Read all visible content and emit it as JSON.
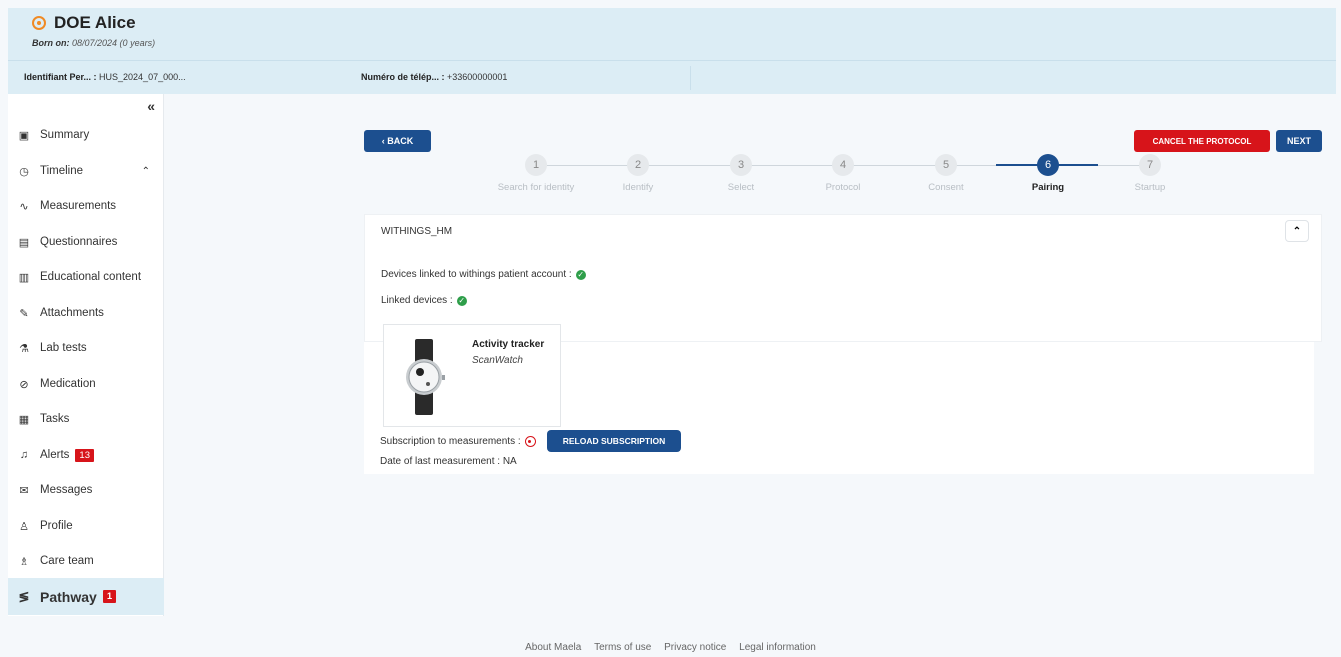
{
  "patient": {
    "name": "DOE Alice",
    "born_label": "Born on:",
    "born_value": "08/07/2024 (0 years)"
  },
  "infobar": {
    "id_label": "Identifiant Per... :",
    "id_value": "HUS_2024_07_000...",
    "phone_label": "Numéro de télép... :",
    "phone_value": "+33600000001"
  },
  "sidebar": {
    "collapse_label": "«",
    "items": [
      {
        "label": "Summary",
        "icon": "summary-icon",
        "glyph": "▣"
      },
      {
        "label": "Timeline",
        "icon": "clock-icon",
        "glyph": "◷"
      },
      {
        "label": "Measurements",
        "icon": "pulse-icon",
        "glyph": "∿"
      },
      {
        "label": "Questionnaires",
        "icon": "questionnaire-icon",
        "glyph": "▤"
      },
      {
        "label": "Educational content",
        "icon": "book-icon",
        "glyph": "▥"
      },
      {
        "label": "Attachments",
        "icon": "paperclip-icon",
        "glyph": "✎"
      },
      {
        "label": "Lab tests",
        "icon": "lab-icon",
        "glyph": "⚗"
      },
      {
        "label": "Medication",
        "icon": "pill-icon",
        "glyph": "⊘"
      },
      {
        "label": "Tasks",
        "icon": "tasks-icon",
        "glyph": "▦"
      },
      {
        "label": "Alerts",
        "icon": "bell-icon",
        "glyph": "♫",
        "badge": "13"
      },
      {
        "label": "Messages",
        "icon": "messages-icon",
        "glyph": "✉"
      },
      {
        "label": "Profile",
        "icon": "person-icon",
        "glyph": "♙"
      },
      {
        "label": "Care team",
        "icon": "care-team-icon",
        "glyph": "♗"
      },
      {
        "label": "Pathway",
        "icon": "pathway-icon",
        "glyph": "≶",
        "badge": "1"
      }
    ]
  },
  "toolbar": {
    "back_label": "BACK",
    "cancel_label": "CANCEL THE PROTOCOL",
    "next_label": "NEXT"
  },
  "stepper": {
    "steps": [
      {
        "num": "1",
        "label": "Search for identity"
      },
      {
        "num": "2",
        "label": "Identify"
      },
      {
        "num": "3",
        "label": "Select"
      },
      {
        "num": "4",
        "label": "Protocol"
      },
      {
        "num": "5",
        "label": "Consent"
      },
      {
        "num": "6",
        "label": "Pairing"
      },
      {
        "num": "7",
        "label": "Startup"
      }
    ],
    "active_step": 6
  },
  "card": {
    "title": "WITHINGS_HM",
    "devices_linked_account": "Devices linked to withings patient account :",
    "linked_devices": "Linked devices :",
    "device_name": "Activity tracker",
    "device_model": "ScanWatch",
    "subscription_label": "Subscription to measurements :",
    "reload_label": "RELOAD SUBSCRIPTION",
    "last_measurement": "Date of last measurement : NA"
  },
  "footer": {
    "links": [
      "About Maela",
      "Terms of use",
      "Privacy notice",
      "Legal information"
    ]
  },
  "colors": {
    "primary": "#1c4f8f",
    "danger": "#d7141a",
    "success": "#2e9e4a",
    "header_bg": "#dcedf5"
  }
}
